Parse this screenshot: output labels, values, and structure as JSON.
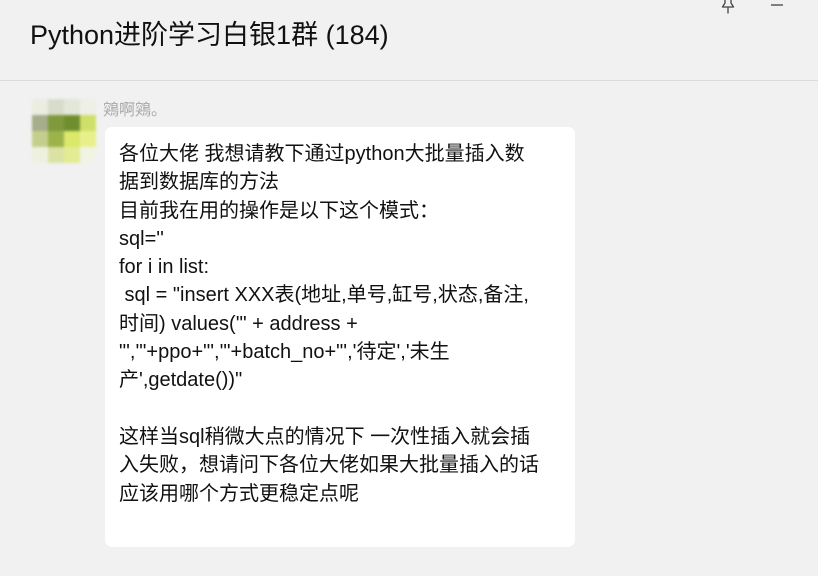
{
  "header": {
    "title": "Python进阶学习白银1群 (184)"
  },
  "icons": {
    "pin": "pin-icon",
    "minimize": "minimize-icon"
  },
  "message": {
    "sender": "鶟啊鶟。",
    "lines": [
      "各位大佬 我想请教下通过python大批量插入数",
      "据到数据库的方法",
      "目前我在用的操作是以下这个模式：",
      "sql=''",
      "for i in list:",
      " sql = \"insert XXX表(地址,单号,缸号,状态,备注,",
      "时间) values('\" + address +",
      "\"','\"+ppo+\"','\"+batch_no+\"','待定','未生",
      "产',getdate())\"",
      "",
      "这样当sql稍微大点的情况下 一次性插入就会插",
      "入失败，想请问下各位大佬如果大批量插入的话",
      "应该用哪个方式更稳定点呢"
    ]
  },
  "colors": {
    "background": "#f1f1f1",
    "bubble": "#ffffff",
    "sender_text": "#a8a8a8",
    "avatar_pixels": [
      "#eaede0",
      "#d8dccb",
      "#e3e7d8",
      "#eef0e6",
      "#a5ad8a",
      "#7f9a3b",
      "#6f8f2e",
      "#cfe06a",
      "#c4cf8e",
      "#9cb34b",
      "#dbe86a",
      "#e8f08c",
      "#eef1e0",
      "#dbe2a3",
      "#e3ec93",
      "#f1f3e4"
    ]
  }
}
